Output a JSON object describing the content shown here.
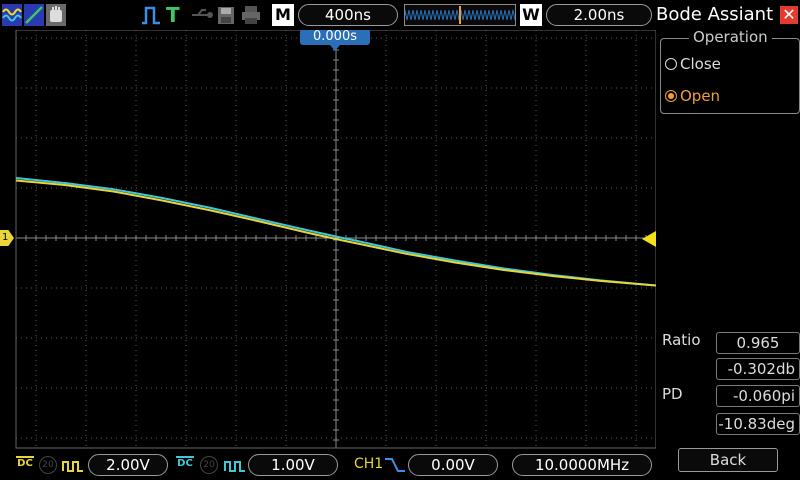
{
  "colors": {
    "ch1": "#e8d53a",
    "ch2": "#3ec8d8",
    "trigger_marker": "#f2e01a",
    "accent_orange": "#f0a030",
    "close_red": "#e43b2e",
    "grid": "#5a5a5a"
  },
  "topbar": {
    "run_mode_icon": "wave-icon",
    "timebase_mode": "M",
    "timebase": "400ns",
    "window_mode": "W",
    "window_value": "2.00ns",
    "trigger_state": "T",
    "icons": [
      "wave-icon",
      "slope-icon",
      "hand-icon",
      "pulse-icon",
      "usb-icon",
      "save-disk-icon",
      "printer-icon"
    ]
  },
  "screen": {
    "trigger_position": "0.000s",
    "ch1_marker": "1",
    "trigger_level_marker": "trigger-level-arrow"
  },
  "chart_data": {
    "type": "line",
    "x": [
      0,
      50,
      100,
      150,
      200,
      250,
      300,
      335,
      350,
      400,
      450,
      500,
      550,
      600,
      656
    ],
    "series": [
      {
        "values": [
          2.4,
          2.2,
          1.95,
          1.6,
          1.2,
          0.75,
          0.3,
          0,
          -0.12,
          -0.55,
          -0.9,
          -1.22,
          -1.48,
          -1.7,
          -1.9
        ]
      },
      {
        "values": [
          2.3,
          2.12,
          1.86,
          1.5,
          1.1,
          0.66,
          0.2,
          -0.1,
          -0.22,
          -0.63,
          -0.98,
          -1.28,
          -1.52,
          -1.72,
          -1.9
        ]
      }
    ],
    "xlim": [
      0,
      656
    ],
    "ylim": [
      -4,
      4
    ],
    "grid": true
  },
  "panel": {
    "title": "Bode Assiant",
    "close_icon": "close-x-icon",
    "operation_label": "Operation",
    "options": [
      {
        "label": "Close",
        "selected": false
      },
      {
        "label": "Open",
        "selected": true
      }
    ],
    "ratio_label": "Ratio",
    "ratio_value": "0.965",
    "ratio_db": "-0.302db",
    "pd_label": "PD",
    "pd_pi": "-0.060pi",
    "pd_deg": "-10.83deg",
    "back_label": "Back"
  },
  "bottombar": {
    "ch1_coupling": "DC",
    "ch1_bw": "20",
    "ch1_scale": "2.00V",
    "ch2_coupling": "DC",
    "ch2_bw": "20",
    "ch2_scale": "1.00V",
    "trigger_source": "CH1",
    "trigger_slope_icon": "falling-edge-icon",
    "trigger_level": "0.00V",
    "frequency": "10.0000MHz"
  }
}
